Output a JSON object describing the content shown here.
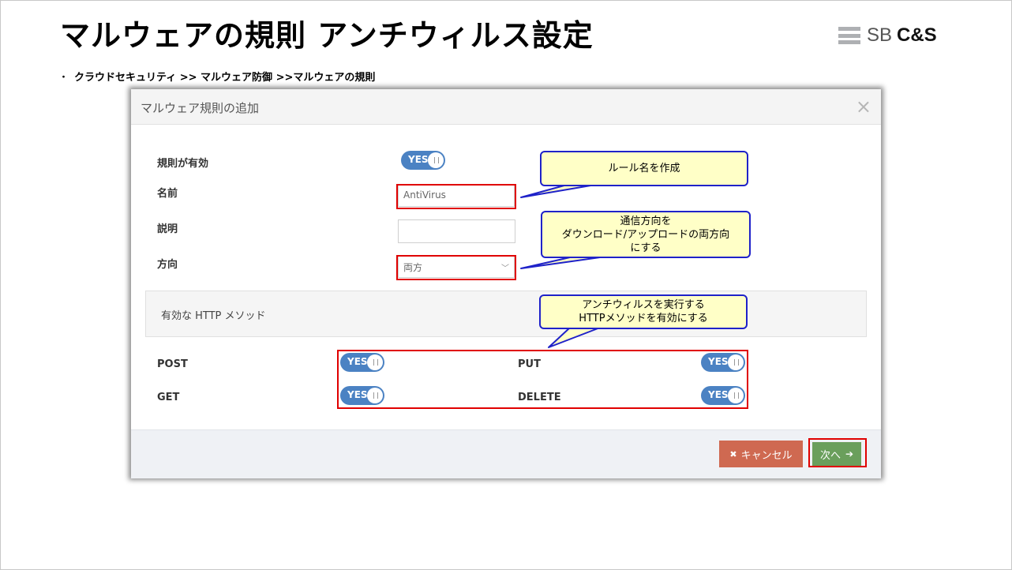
{
  "slide": {
    "title": "マルウェアの規則 アンチウィルス設定",
    "logo_sb": "SB",
    "logo_cs": "C&S",
    "bullet_mark": "・",
    "breadcrumb": "クラウドセキュリティ >> マルウェア防御 >>マルウェアの規則"
  },
  "modal": {
    "title": "マルウェア規則の追加",
    "close_glyph": "×",
    "rule_enabled_label": "規則が有効",
    "rule_enabled_toggle": "YES",
    "name_label": "名前",
    "name_value": "AntiVirus",
    "description_label": "説明",
    "description_value": "",
    "direction_label": "方向",
    "direction_value": "両方",
    "http_section_title": "有効な HTTP メソッド",
    "methods": [
      {
        "label": "POST",
        "toggle": "YES"
      },
      {
        "label": "PUT",
        "toggle": "YES"
      },
      {
        "label": "GET",
        "toggle": "YES"
      },
      {
        "label": "DELETE",
        "toggle": "YES"
      }
    ],
    "footer": {
      "cancel_icon": "✖",
      "cancel_label": "キャンセル",
      "next_label": "次へ",
      "next_icon": "➔"
    }
  },
  "callouts": {
    "name": "ルール名を作成",
    "direction_line1": "通信方向を",
    "direction_line2": "ダウンロード/アップロードの両方向",
    "direction_line3": "にする",
    "http_line1": "アンチウィルスを実行する",
    "http_line2": "HTTPメソッドを有効にする"
  },
  "colors": {
    "toggle_on": "#4b82c3",
    "cancel_button": "#cf6951",
    "next_button": "#6a9f5c",
    "highlight_box": "#e00000",
    "callout_fill": "#ffffc7",
    "callout_border": "#1f22c9"
  }
}
